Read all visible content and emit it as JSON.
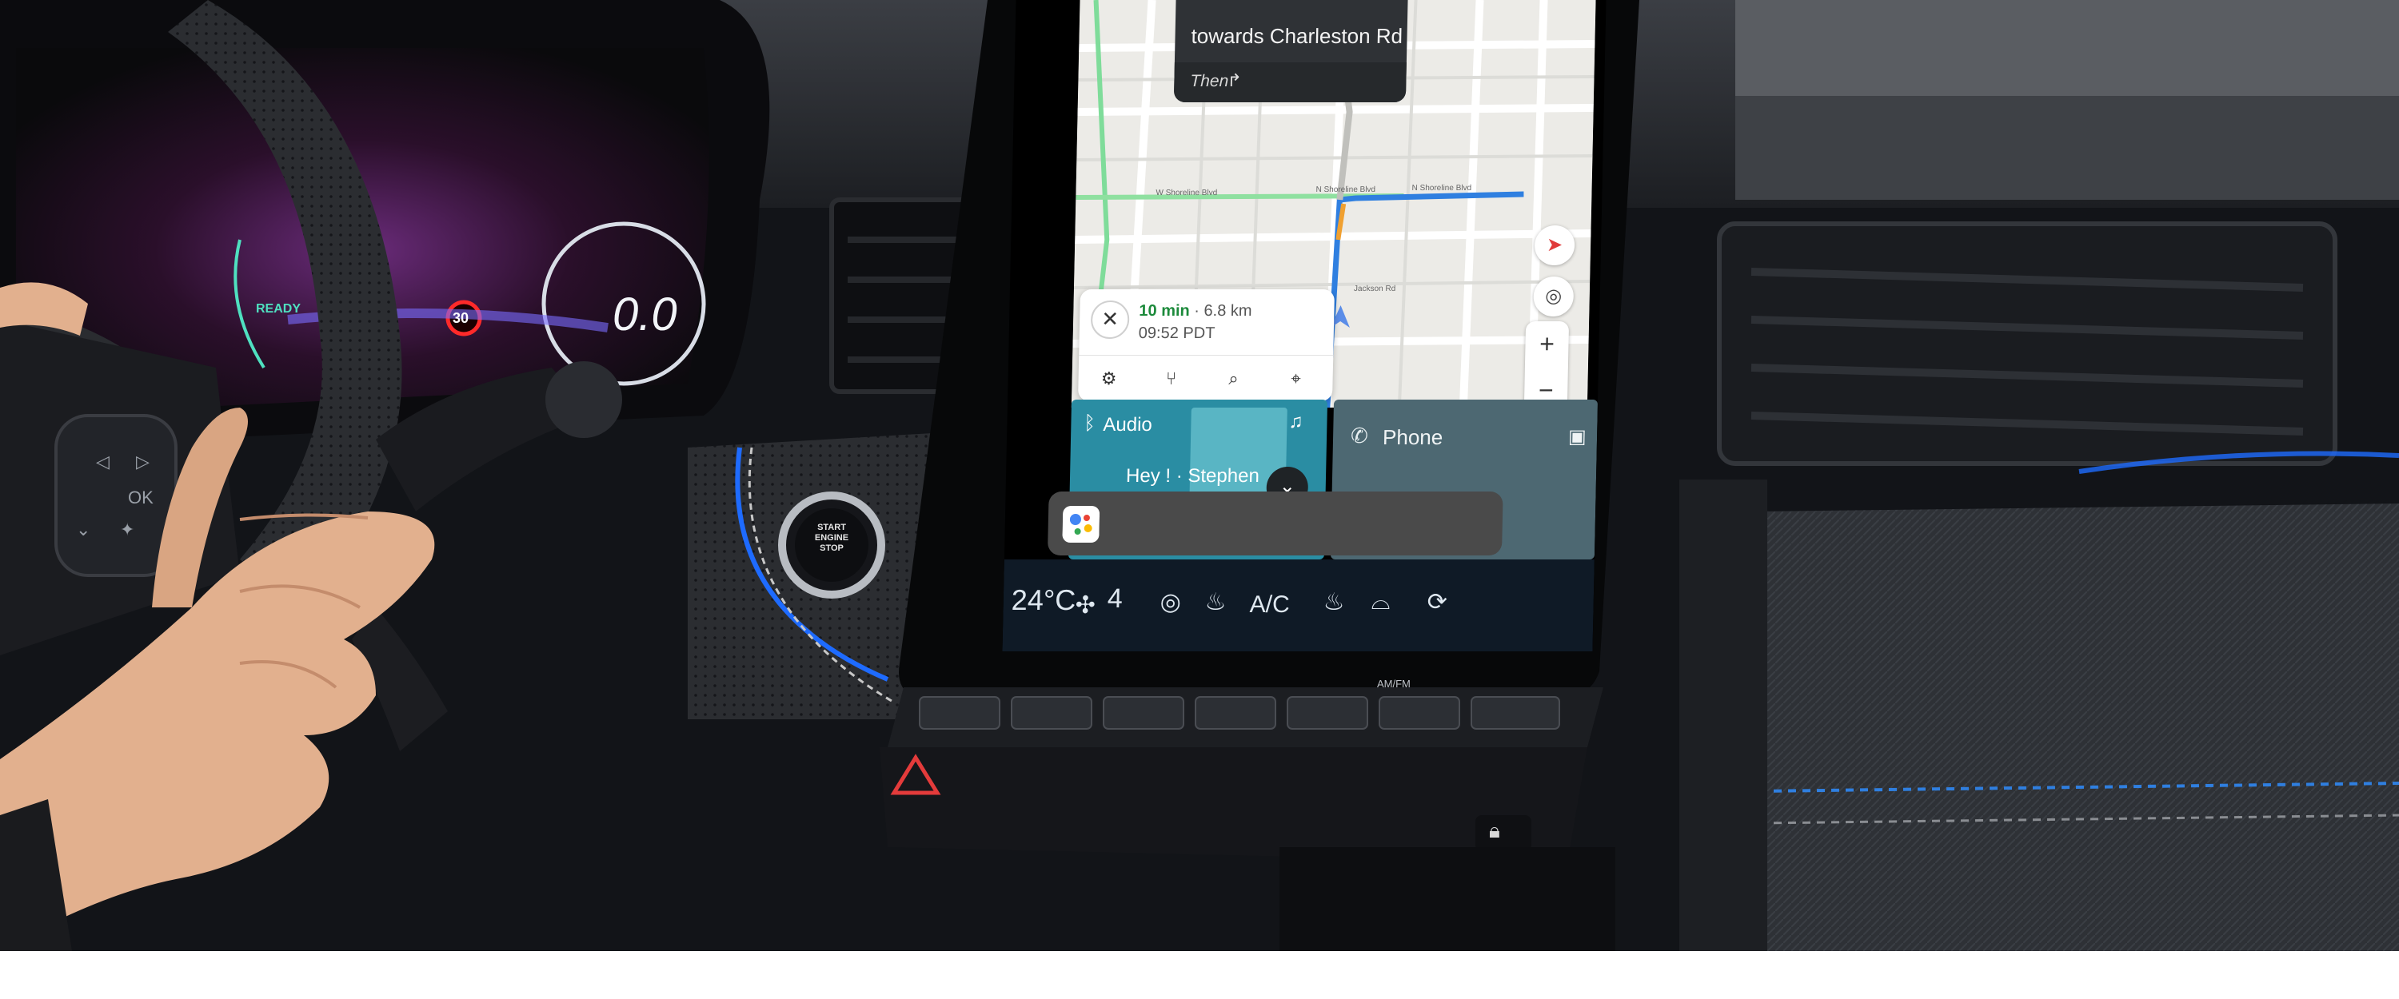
{
  "navigation": {
    "next_street": "towards Charleston Rd",
    "then_label": "Then",
    "trip_duration": "10 min",
    "trip_separator": "·",
    "trip_distance": "6.8 km",
    "trip_arrival": "09:52 PDT",
    "map_labels": [
      "W Shoreline Blvd",
      "N Shoreline Blvd",
      "N Shoreline Blvd",
      "Jackson Rd"
    ]
  },
  "audio": {
    "label": "Audio",
    "track_title": "Hey ! · Stephen"
  },
  "phone": {
    "label": "Phone"
  },
  "climate": {
    "temperature": "24°C",
    "fan_level": "4",
    "ac_label": "A/C"
  },
  "cluster": {
    "speed": "0.0",
    "speed_limit": "30",
    "ready_label": "READY"
  },
  "console": {
    "start_button_line1": "START",
    "start_button_line2": "ENGINE",
    "start_button_line3": "STOP",
    "hard_button_label": "AM/FM"
  },
  "colors": {
    "route_blue": "#2f7fe0",
    "eta_green": "#1c8a3b",
    "audio_tile": "#2a8da3",
    "phone_tile": "#4d6872",
    "ambient_blue": "#1e6bff"
  },
  "icons": [
    "bluetooth-icon",
    "settings-icon",
    "route-options-icon",
    "search-icon",
    "pin-icon",
    "compass-icon",
    "recenter-icon",
    "phone-icon",
    "contact-icon",
    "fan-icon",
    "seat-heat-icon",
    "defrost-icon",
    "steering-heat-icon",
    "hazard-icon",
    "lock-icon",
    "assistant-icon"
  ]
}
